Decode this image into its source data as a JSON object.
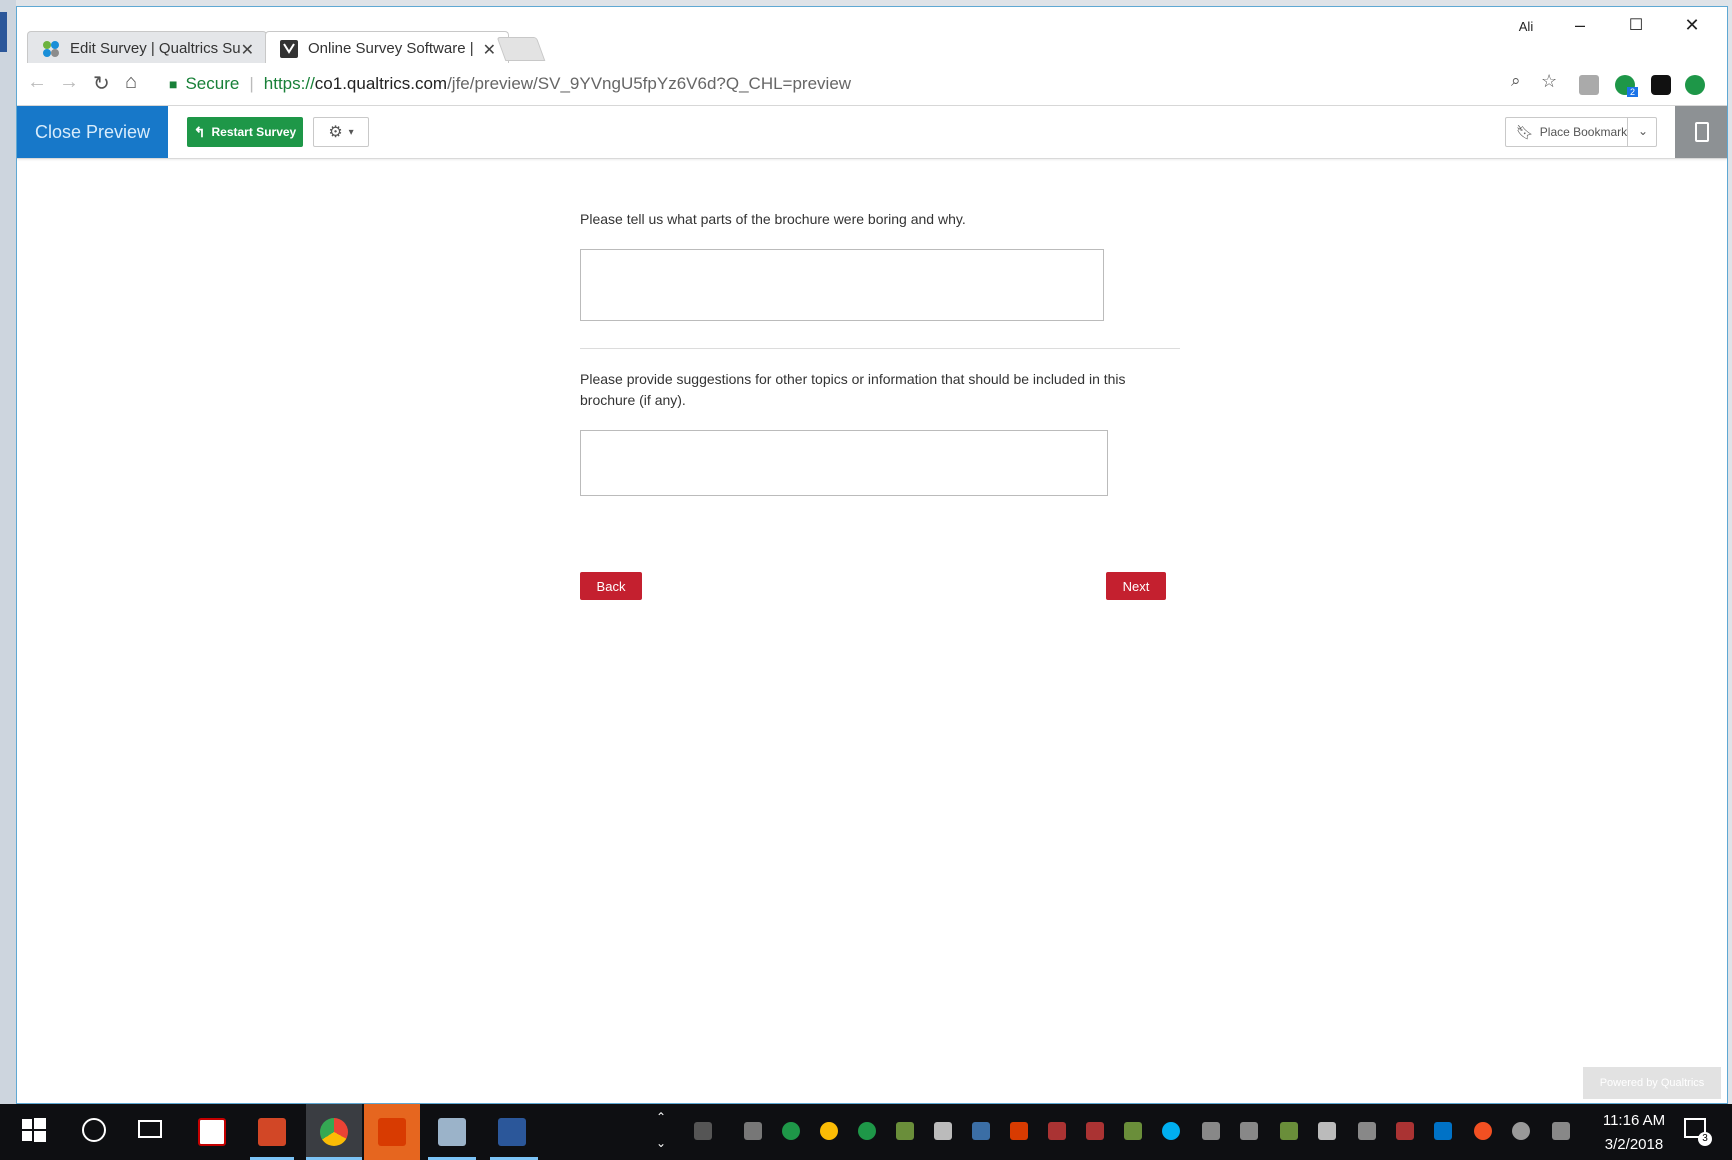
{
  "browser": {
    "tabs": [
      {
        "title": "Edit Survey | Qualtrics Su"
      },
      {
        "title": "Online Survey Software |"
      }
    ],
    "account_label": "Ali",
    "address": {
      "secure_label": "Secure",
      "url_scheme": "https://",
      "url_host": "co1.qualtrics.com",
      "url_path": "/jfe/preview/SV_9YVngU5fpYz6V6d?Q_CHL=preview"
    },
    "extension_badge": "2"
  },
  "preview_bar": {
    "close_label": "Close Preview",
    "restart_label": "Restart Survey",
    "bookmark_label": "Place Bookmark"
  },
  "survey": {
    "q1": {
      "text": "Please tell us what parts of the brochure were boring and why.",
      "value": ""
    },
    "q2": {
      "text": "Please provide suggestions for other topics or information that should be included in this brochure (if any).",
      "value": ""
    },
    "back_label": "Back",
    "next_label": "Next",
    "powered_by": "Powered by Qualtrics"
  },
  "taskbar": {
    "time": "11:16 AM",
    "date": "3/2/2018",
    "notification_count": "3"
  },
  "colors": {
    "close_preview_bg": "#1778c9",
    "restart_bg": "#1e9748",
    "nav_button_bg": "#c4202f"
  }
}
